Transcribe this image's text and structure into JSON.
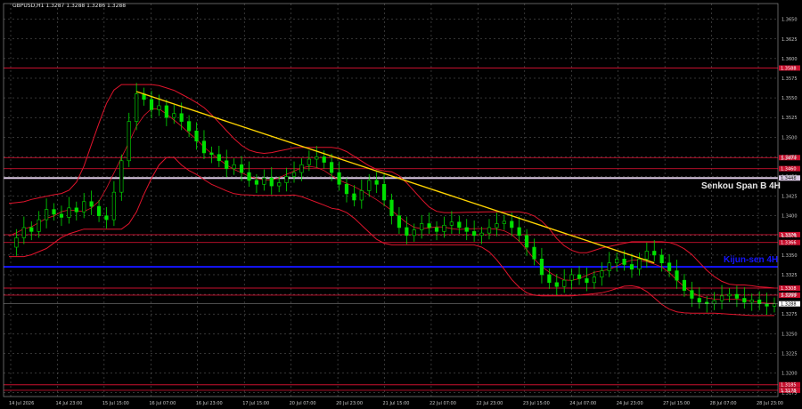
{
  "chart_data": {
    "type": "candlestick",
    "title": "GBPUSD,H1  1.3287 1.3288 1.3286 1.3288",
    "ylim": [
      1.317,
      1.367
    ],
    "y_ticks": [
      "1.3650",
      "1.3625",
      "1.3600",
      "1.3575",
      "1.3550",
      "1.3525",
      "1.3500",
      "1.3475",
      "1.3450",
      "1.3425",
      "1.3400",
      "1.3375",
      "1.3350",
      "1.3325",
      "1.3300",
      "1.3275",
      "1.3250",
      "1.3225",
      "1.3200",
      "1.3175"
    ],
    "x_ticks": [
      "14 Jul 2026",
      "14 Jul 23:00",
      "15 Jul 15:00",
      "16 Jul 07:00",
      "16 Jul 23:00",
      "17 Jul 15:00",
      "20 Jul 07:00",
      "20 Jul 23:00",
      "21 Jul 15:00",
      "22 Jul 07:00",
      "22 Jul 23:00",
      "23 Jul 15:00",
      "24 Jul 07:00",
      "24 Jul 23:00",
      "27 Jul 15:00",
      "28 Jul 07:00",
      "28 Jul 23:00"
    ],
    "grid": true,
    "current_price": "1.3288",
    "price_path": [
      1.336,
      1.3372,
      1.3385,
      1.338,
      1.3395,
      1.3408,
      1.3402,
      1.3398,
      1.341,
      1.3405,
      1.3418,
      1.3412,
      1.34,
      1.3395,
      1.343,
      1.347,
      1.352,
      1.3555,
      1.3548,
      1.3535,
      1.354,
      1.3525,
      1.353,
      1.352,
      1.3508,
      1.3495,
      1.348,
      1.3478,
      1.347,
      1.346,
      1.3465,
      1.3455,
      1.3445,
      1.344,
      1.3448,
      1.3438,
      1.3442,
      1.345,
      1.3455,
      1.3465,
      1.3472,
      1.3475,
      1.3468,
      1.3455,
      1.344,
      1.3428,
      1.342,
      1.3432,
      1.3445,
      1.344,
      1.342,
      1.34,
      1.3385,
      1.3375,
      1.3382,
      1.339,
      1.3385,
      1.338,
      1.3388,
      1.3392,
      1.3385,
      1.338,
      1.3375,
      1.3378,
      1.3385,
      1.339,
      1.3393,
      1.3385,
      1.3375,
      1.336,
      1.3345,
      1.3325,
      1.3315,
      1.331,
      1.3318,
      1.3325,
      1.332,
      1.3315,
      1.3322,
      1.333,
      1.334,
      1.3345,
      1.3338,
      1.3332,
      1.3345,
      1.3355,
      1.335,
      1.334,
      1.333,
      1.3318,
      1.3305,
      1.3295,
      1.329,
      1.3288,
      1.3292,
      1.3298,
      1.33,
      1.3295,
      1.329,
      1.3293,
      1.3288,
      1.3285,
      1.3288
    ],
    "trendline": {
      "from": [
        17,
        1.3558
      ],
      "to": [
        86,
        1.334
      ]
    },
    "levels_red": [
      1.3588,
      1.3474,
      1.346,
      1.3376,
      1.3366,
      1.3308,
      1.3299,
      1.3185,
      1.3178
    ],
    "level_labels": [
      "1.3588",
      "1.3474",
      "1.3460",
      "1.3376",
      "1.3366",
      "1.3308",
      "1.3299",
      "1.3185",
      "1.3178"
    ],
    "senkou_span_b": {
      "value": 1.3448,
      "label": "Senkou Span B 4H",
      "price_label": "1.3448",
      "color": "#d9c7e3"
    },
    "kijun_sen": {
      "value": 1.3335,
      "label": "Kijun-sen 4H",
      "color": "#1414ff"
    },
    "colors": {
      "bull": "#00e000",
      "bear": "#00e000",
      "trend": "#ffd400",
      "level": "#c8102e",
      "band": "#e0142c",
      "grid": "#6a6a6a"
    }
  }
}
